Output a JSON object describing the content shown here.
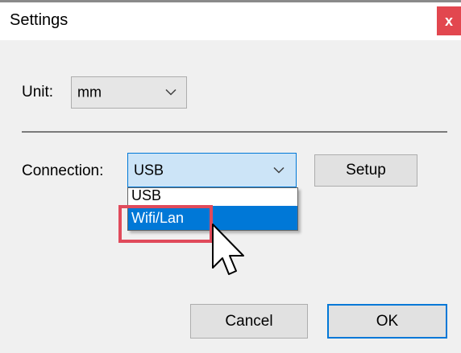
{
  "window": {
    "title": "Settings",
    "close_label": "x"
  },
  "unit": {
    "label": "Unit:",
    "value": "mm"
  },
  "connection": {
    "label": "Connection:",
    "value": "USB",
    "options": [
      "USB",
      "Wifi/Lan"
    ],
    "hovered_option": "Wifi/Lan"
  },
  "buttons": {
    "setup": "Setup",
    "cancel": "Cancel",
    "ok": "OK"
  },
  "colors": {
    "selection": "#0078d7",
    "close_button": "#e2474f",
    "highlight_box": "#e04a5b"
  },
  "icons": {
    "unit_chevron": "chevron-down-icon",
    "connection_chevron": "chevron-down-icon",
    "cursor": "arrow-cursor-icon"
  }
}
